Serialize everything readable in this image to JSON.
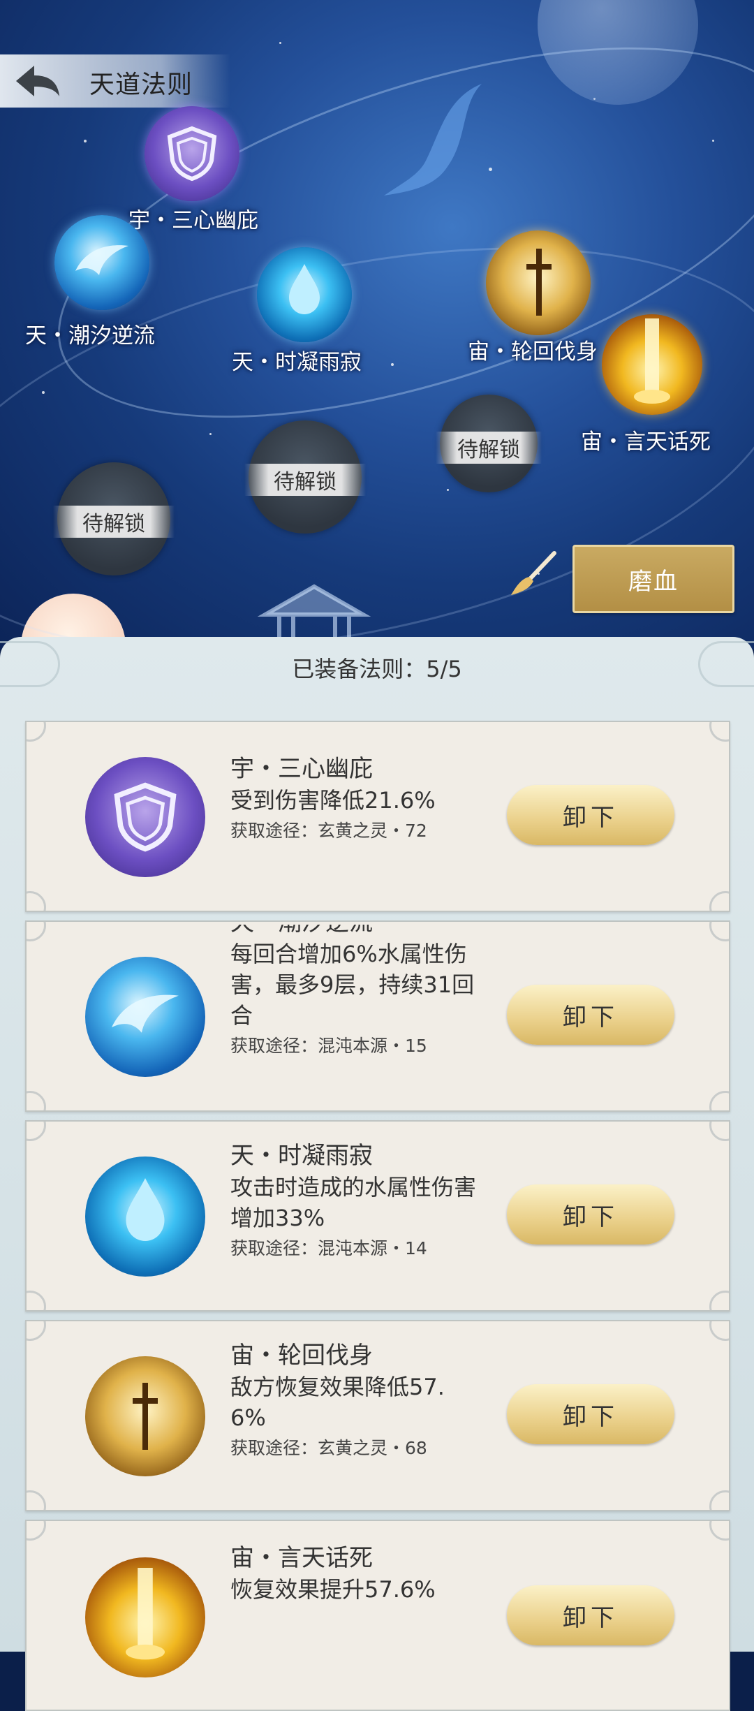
{
  "header": {
    "title": "天道法则",
    "back_icon": "back-arrow-icon"
  },
  "map": {
    "nodes": [
      {
        "label": "宇・三心幽庇",
        "icon": "shield-icon"
      },
      {
        "label": "天・潮汐逆流",
        "icon": "wave-icon"
      },
      {
        "label": "天・时凝雨寂",
        "icon": "water-drop-icon"
      },
      {
        "label": "宙・轮回伐身",
        "icon": "swords-icon"
      },
      {
        "label": "宙・言天话死",
        "icon": "light-pillar-icon"
      }
    ],
    "locked_label": "待解锁",
    "brush_icon": "brush-icon",
    "moxue_button": "磨血"
  },
  "equipped": {
    "header": "已装备法则：5/5",
    "unequip_label": "卸下",
    "items": [
      {
        "name": "宇・三心幽庇",
        "desc": "受到伤害降低21.6%",
        "source": "获取途径：玄黄之灵・72",
        "icon": "shield-icon"
      },
      {
        "name": "天・潮汐逆流",
        "desc": "每回合增加6%水属性伤害，最多9层，持续31回合",
        "source": "获取途径：混沌本源・15",
        "icon": "wave-icon"
      },
      {
        "name": "天・时凝雨寂",
        "desc": "攻击时造成的水属性伤害增加33%",
        "source": "获取途径：混沌本源・14",
        "icon": "water-drop-icon"
      },
      {
        "name": "宙・轮回伐身",
        "desc": "敌方恢复效果降低57.6%",
        "source": "获取途径：玄黄之灵・68",
        "icon": "swords-icon"
      },
      {
        "name": "宙・言天话死",
        "desc": "恢复效果提升57.6%",
        "source": "",
        "icon": "light-pillar-icon"
      }
    ]
  },
  "colors": {
    "button_gold": "#e8cf8a",
    "moxue_gold": "#c2a257",
    "panel_bg": "#dde7ea",
    "card_bg": "#f1ede6"
  }
}
